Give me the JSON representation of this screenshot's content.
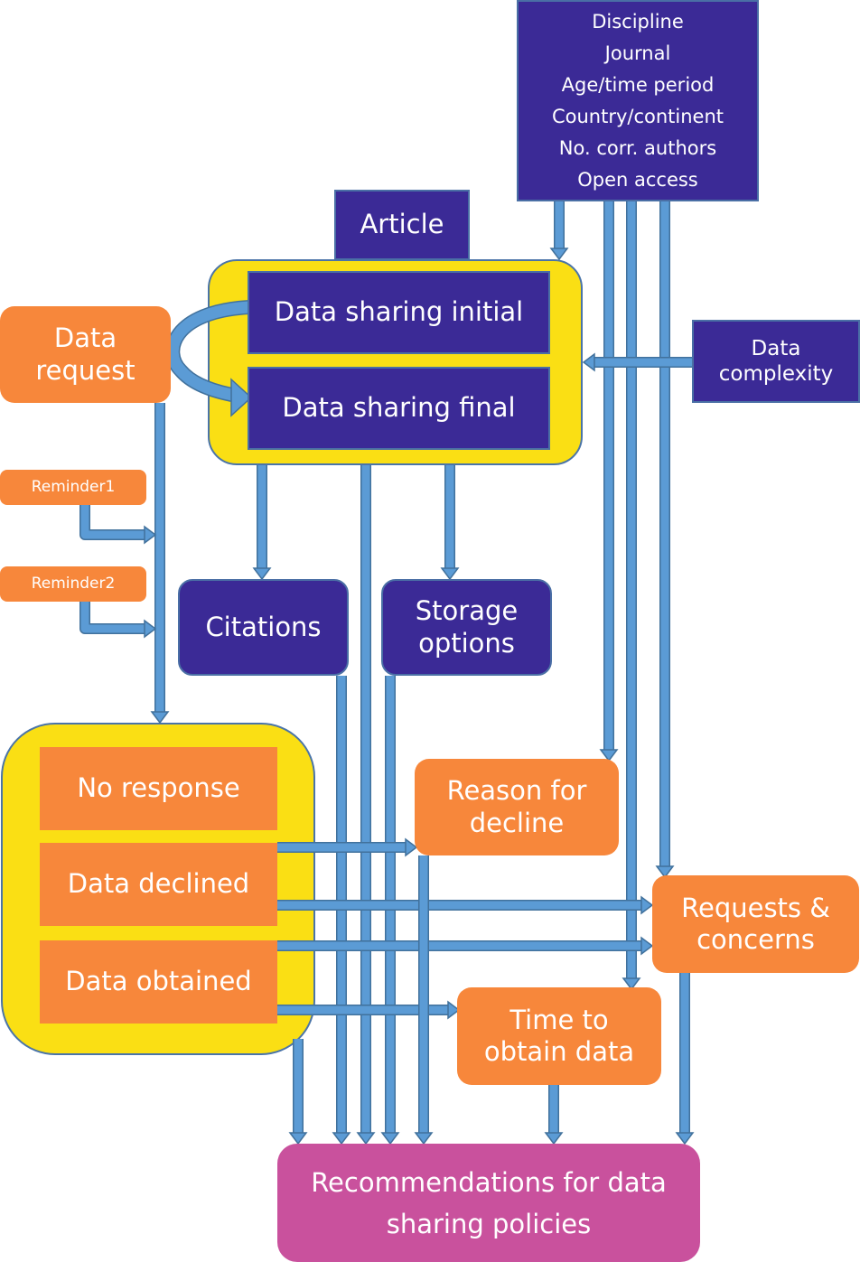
{
  "diagram": {
    "colors": {
      "purple": "#3b2a96",
      "orange": "#f7873b",
      "magenta": "#c9519d",
      "yellow": "#fadf14",
      "arrow": "#5b9bd5",
      "arrow_outline": "#41719c"
    },
    "nodes": {
      "article_factors": "Discipline\nJournal\nAge/time period\nCountry/continent\nNo. corr. authors\nOpen access",
      "article": "Article",
      "data_sharing_initial": "Data sharing initial",
      "data_sharing_final": "Data sharing final",
      "data_request": "Data\nrequest",
      "data_complexity": "Data\ncomplexity",
      "reminder1": "Reminder1",
      "reminder2": "Reminder2",
      "citations": "Citations",
      "storage_options": "Storage\noptions",
      "no_response": "No response",
      "data_declined": "Data declined",
      "data_obtained": "Data obtained",
      "reason_for_decline": "Reason for\ndecline",
      "requests_concerns": "Requests &\nconcerns",
      "time_to_obtain": "Time to\nobtain data",
      "recommendations": "Recommendations for data\nsharing policies"
    },
    "edges": [
      {
        "from": "article_factors",
        "to": "data_sharing_group"
      },
      {
        "from": "article_factors",
        "to": "reason_for_decline"
      },
      {
        "from": "article_factors",
        "to": "time_to_obtain"
      },
      {
        "from": "article_factors",
        "to": "requests_concerns"
      },
      {
        "from": "data_complexity",
        "to": "data_sharing_group"
      },
      {
        "from": "data_sharing_initial",
        "to": "data_sharing_final",
        "via": "data_request"
      },
      {
        "from": "data_request",
        "to": "response_group"
      },
      {
        "from": "reminder1",
        "to": "data_request_line"
      },
      {
        "from": "reminder2",
        "to": "data_request_line"
      },
      {
        "from": "data_sharing_group",
        "to": "citations"
      },
      {
        "from": "data_sharing_group",
        "to": "storage_options"
      },
      {
        "from": "data_sharing_group",
        "to": "recommendations"
      },
      {
        "from": "citations",
        "to": "recommendations"
      },
      {
        "from": "storage_options",
        "to": "recommendations"
      },
      {
        "from": "data_declined",
        "to": "reason_for_decline"
      },
      {
        "from": "data_declined",
        "to": "requests_concerns"
      },
      {
        "from": "data_obtained",
        "to": "requests_concerns"
      },
      {
        "from": "data_obtained",
        "to": "time_to_obtain"
      },
      {
        "from": "response_group",
        "to": "recommendations"
      },
      {
        "from": "reason_for_decline",
        "to": "recommendations"
      },
      {
        "from": "time_to_obtain",
        "to": "recommendations"
      },
      {
        "from": "requests_concerns",
        "to": "recommendations"
      }
    ]
  }
}
